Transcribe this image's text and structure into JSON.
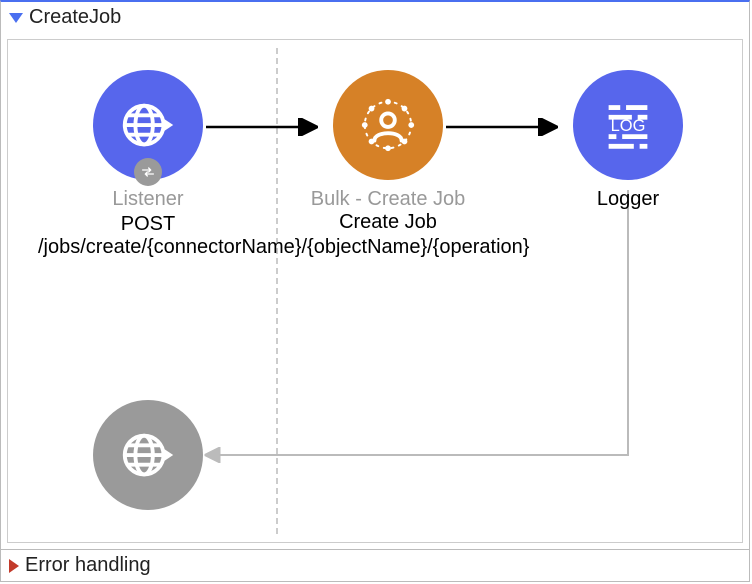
{
  "flow": {
    "title": "CreateJob",
    "errorSectionTitle": "Error handling"
  },
  "nodes": {
    "listener": {
      "type": "Listener",
      "path": "POST /jobs/create/{connectorName}/{objectName}/{operation}",
      "icon": "globe-arrow",
      "color": "blue"
    },
    "createJob": {
      "type": "Bulk - Create Job",
      "label": "Create Job",
      "icon": "user-beads",
      "color": "orange"
    },
    "logger": {
      "type": "",
      "label": "Logger",
      "icon": "log",
      "color": "blue"
    },
    "response": {
      "icon": "globe-arrow",
      "color": "gray"
    }
  }
}
